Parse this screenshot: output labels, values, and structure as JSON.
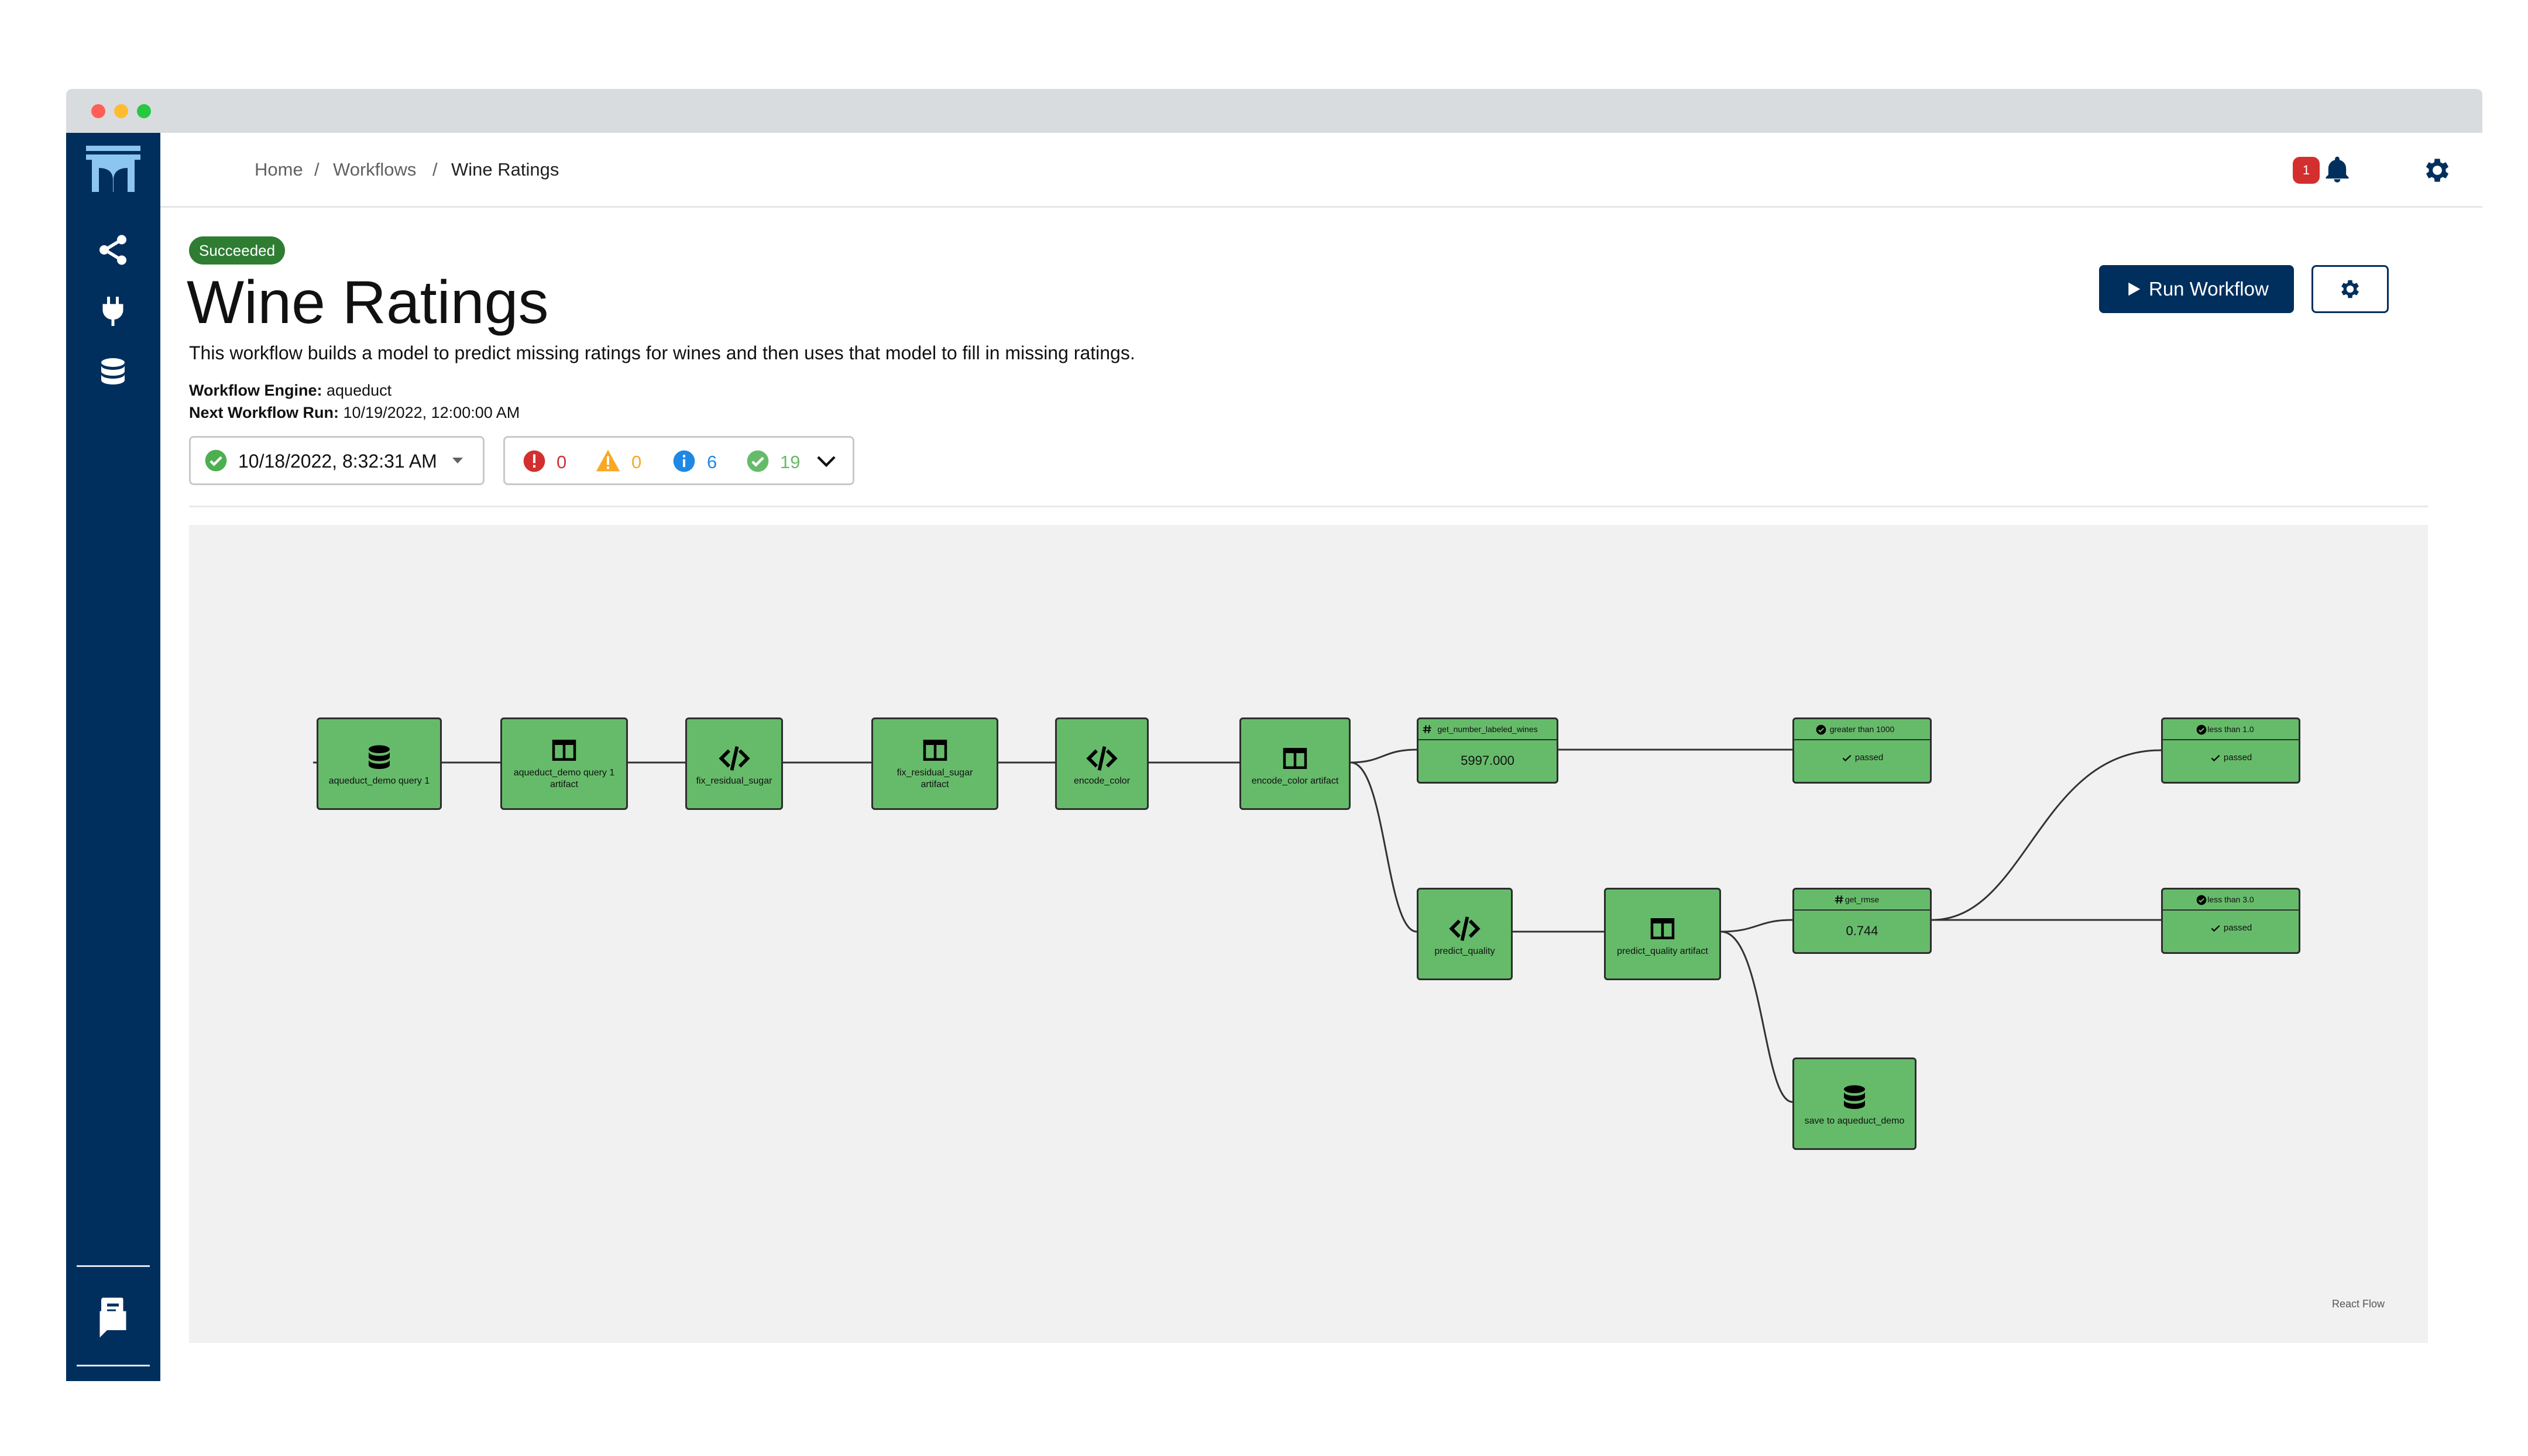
{
  "window": {
    "controls": [
      "close",
      "minimize",
      "maximize"
    ]
  },
  "sidebar": {
    "logo": "aqueduct-logo",
    "items": [
      "share-icon",
      "plug-icon",
      "database-icon"
    ],
    "bottom_items": [
      "book-icon",
      "chat-icon"
    ]
  },
  "breadcrumb": {
    "home": "Home",
    "sep1": "/",
    "workflows": "Workflows",
    "sep2": "/",
    "current": "Wine Ratings"
  },
  "notifications": {
    "count": "1"
  },
  "workflow": {
    "status": "Succeeded",
    "title": "Wine Ratings",
    "description": "This workflow builds a model to predict missing ratings for wines and then uses that model to fill in missing ratings.",
    "engine_label": "Workflow Engine:",
    "engine_value": "aqueduct",
    "next_run_label": "Next Workflow Run:",
    "next_run_value": "10/19/2022, 12:00:00 AM"
  },
  "actions": {
    "run_label": "Run Workflow"
  },
  "run_selector": {
    "selected": "10/18/2022, 8:32:31 AM"
  },
  "counts": {
    "errors": "0",
    "warnings": "0",
    "info": "6",
    "success": "19"
  },
  "colors": {
    "navy": "#002f5d",
    "node_green": "#66bb6a",
    "success": "#2e7d32",
    "error": "#d32f2f",
    "warning": "#f9a825",
    "info": "#1e88e5",
    "success_light": "#4caf50"
  },
  "graph": {
    "nodes": {
      "n1": {
        "label": "aqueduct_demo query 1",
        "icon": "database-icon"
      },
      "n2": {
        "label": "aqueduct_demo query 1 artifact",
        "icon": "table-icon"
      },
      "n3": {
        "label": "fix_residual_sugar",
        "icon": "code-icon"
      },
      "n4": {
        "label": "fix_residual_sugar artifact",
        "icon": "table-icon"
      },
      "n5": {
        "label": "encode_color",
        "icon": "code-icon"
      },
      "n6": {
        "label": "encode_color artifact",
        "icon": "table-icon"
      },
      "n7": {
        "label": "get_number_labeled_wines",
        "value": "5997.000",
        "icon": "hash-icon"
      },
      "n8": {
        "label": "greater than 1000",
        "status": "passed",
        "icon": "check-circle-icon"
      },
      "n9": {
        "label": "predict_quality",
        "icon": "code-icon"
      },
      "n10": {
        "label": "predict_quality artifact",
        "icon": "table-icon"
      },
      "n11": {
        "label": "get_rmse",
        "value": "0.744",
        "icon": "hash-icon"
      },
      "n12": {
        "label": "less than 1.0",
        "status": "passed",
        "icon": "check-circle-icon"
      },
      "n13": {
        "label": "less than 3.0",
        "status": "passed",
        "icon": "check-circle-icon"
      },
      "n14": {
        "label": "save to aqueduct_demo",
        "icon": "database-icon"
      }
    },
    "attribution": "React Flow"
  }
}
